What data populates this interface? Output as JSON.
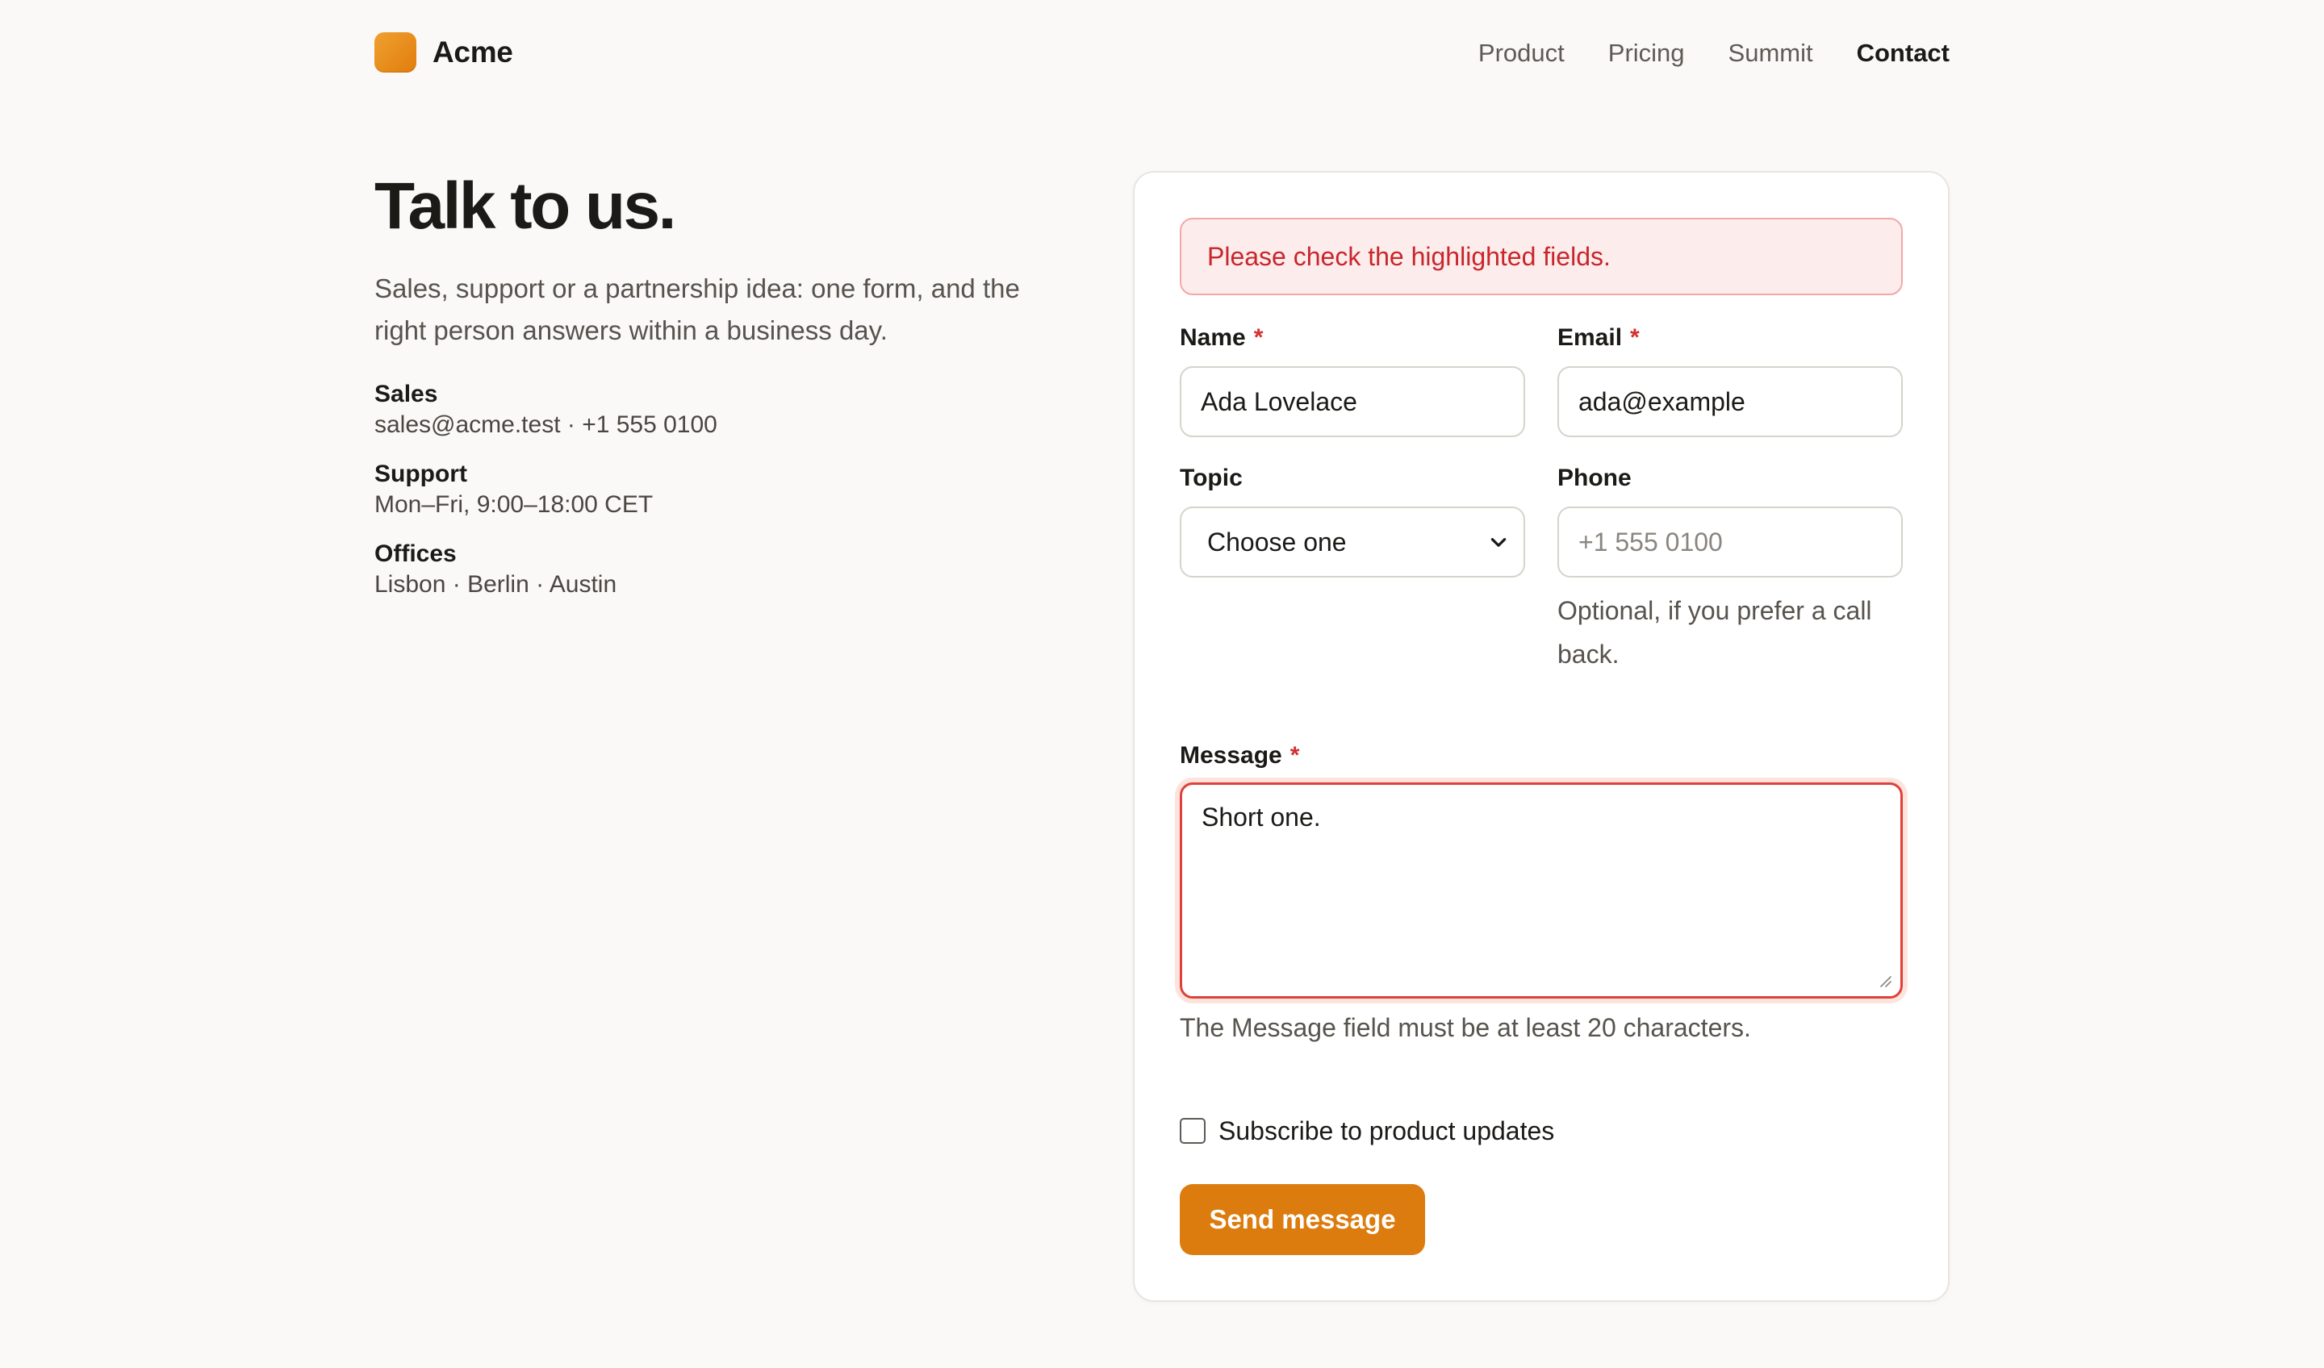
{
  "brand": {
    "name": "Acme",
    "color": "#e8890f"
  },
  "nav": [
    {
      "label": "Product",
      "active": false
    },
    {
      "label": "Pricing",
      "active": false
    },
    {
      "label": "Summit",
      "active": false
    },
    {
      "label": "Contact",
      "active": true
    }
  ],
  "hero": {
    "title": "Talk to us.",
    "intro": "Sales, support or a partnership idea: one form, and the right person answers within a business day."
  },
  "contact_info": [
    {
      "label": "Sales",
      "value": "sales@acme.test · +1 555 0100"
    },
    {
      "label": "Support",
      "value": "Mon–Fri, 9:00–18:00 CET"
    },
    {
      "label": "Offices",
      "value": "Lisbon · Berlin · Austin"
    }
  ],
  "form": {
    "alert": "Please check the highlighted fields.",
    "name": {
      "label": "Name",
      "required": "*",
      "value": "Ada Lovelace"
    },
    "email": {
      "label": "Email",
      "required": "*",
      "value": "ada@example"
    },
    "topic": {
      "label": "Topic",
      "selected": "Choose one"
    },
    "phone": {
      "label": "Phone",
      "placeholder": "+1 555 0100",
      "hint": "Optional, if you prefer a call back."
    },
    "message": {
      "label": "Message",
      "required": "*",
      "value": "Short one.",
      "error": "The Message field must be at least 20 characters."
    },
    "subscribe": {
      "label": "Subscribe to product updates",
      "checked": false
    },
    "submit_label": "Send message"
  },
  "colors": {
    "accent": "#dd7c0e",
    "error": "#d32f2f",
    "error_bg": "#fdecec"
  }
}
